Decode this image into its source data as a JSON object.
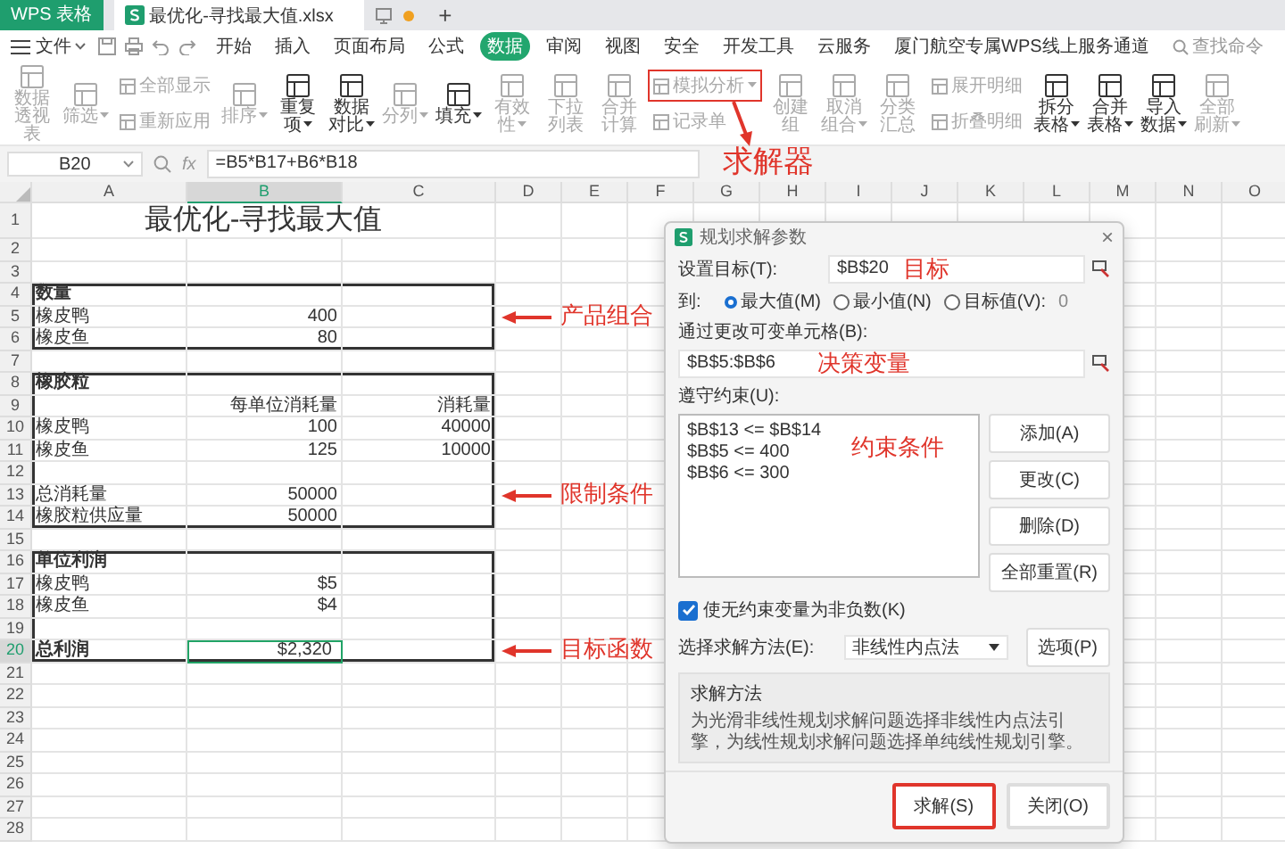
{
  "title_bar": {
    "app_tab": "WPS 表格",
    "file_tab": "最优化-寻找最大值.xlsx",
    "new_tab": "+"
  },
  "menu": {
    "file": "文件",
    "tabs": [
      {
        "label": "开始",
        "selected": false
      },
      {
        "label": "插入",
        "selected": false
      },
      {
        "label": "页面布局",
        "selected": false
      },
      {
        "label": "公式",
        "selected": false
      },
      {
        "label": "数据",
        "selected": true
      },
      {
        "label": "审阅",
        "selected": false
      },
      {
        "label": "视图",
        "selected": false
      },
      {
        "label": "安全",
        "selected": false
      },
      {
        "label": "开发工具",
        "selected": false
      },
      {
        "label": "云服务",
        "selected": false
      },
      {
        "label": "厦门航空专属WPS线上服务通道",
        "selected": false
      }
    ],
    "search_placeholder": "查找命令"
  },
  "toolbar": [
    {
      "kind": "large",
      "label": "数据透视表",
      "dropdown": false,
      "disabled": true
    },
    {
      "kind": "large",
      "label": "筛选",
      "dropdown": true,
      "disabled": true
    },
    {
      "kind": "stack",
      "items": [
        {
          "label": "全部显示",
          "dropdown": false,
          "disabled": true,
          "highlighted": false
        },
        {
          "label": "重新应用",
          "dropdown": false,
          "disabled": true,
          "highlighted": false
        }
      ]
    },
    {
      "kind": "large",
      "label": "排序",
      "dropdown": true,
      "disabled": true
    },
    {
      "kind": "large",
      "label": "重复项",
      "dropdown": true,
      "disabled": false
    },
    {
      "kind": "large",
      "label": "数据对比",
      "dropdown": true,
      "disabled": false
    },
    {
      "kind": "large",
      "label": "分列",
      "dropdown": true,
      "disabled": true
    },
    {
      "kind": "large",
      "label": "填充",
      "dropdown": true,
      "disabled": false
    },
    {
      "kind": "large",
      "label": "有效性",
      "dropdown": true,
      "disabled": true
    },
    {
      "kind": "large",
      "label": "下拉列表",
      "dropdown": false,
      "disabled": true
    },
    {
      "kind": "large",
      "label": "合并计算",
      "dropdown": false,
      "disabled": true
    },
    {
      "kind": "stack",
      "items": [
        {
          "label": "模拟分析",
          "dropdown": true,
          "disabled": true,
          "highlighted": true,
          "note": "求解器"
        },
        {
          "label": "记录单",
          "dropdown": false,
          "disabled": true,
          "highlighted": false
        }
      ]
    },
    {
      "kind": "large",
      "label": "创建组",
      "dropdown": false,
      "disabled": true
    },
    {
      "kind": "large",
      "label": "取消组合",
      "dropdown": true,
      "disabled": true
    },
    {
      "kind": "large",
      "label": "分类汇总",
      "dropdown": false,
      "disabled": true
    },
    {
      "kind": "stack",
      "items": [
        {
          "label": "展开明细",
          "dropdown": false,
          "disabled": true,
          "highlighted": false
        },
        {
          "label": "折叠明细",
          "dropdown": false,
          "disabled": true,
          "highlighted": false
        }
      ]
    },
    {
      "kind": "large",
      "label": "拆分表格",
      "dropdown": true,
      "disabled": false
    },
    {
      "kind": "large",
      "label": "合并表格",
      "dropdown": true,
      "disabled": false
    },
    {
      "kind": "large",
      "label": "导入数据",
      "dropdown": true,
      "disabled": false
    },
    {
      "kind": "large",
      "label": "全部刷新",
      "dropdown": true,
      "disabled": true
    }
  ],
  "formula_bar": {
    "name_box": "B20",
    "fx_label": "fx",
    "formula": "=B5*B17+B6*B18"
  },
  "sheet": {
    "columns": [
      {
        "label": "A",
        "selected": false
      },
      {
        "label": "B",
        "selected": true
      },
      {
        "label": "C",
        "selected": false
      },
      {
        "label": "D",
        "selected": false
      },
      {
        "label": "E",
        "selected": false
      },
      {
        "label": "F",
        "selected": false
      },
      {
        "label": "G",
        "selected": false
      },
      {
        "label": "H",
        "selected": false
      },
      {
        "label": "I",
        "selected": false
      },
      {
        "label": "J",
        "selected": false
      },
      {
        "label": "K",
        "selected": false
      },
      {
        "label": "L",
        "selected": false
      },
      {
        "label": "M",
        "selected": false
      },
      {
        "label": "N",
        "selected": false
      },
      {
        "label": "O",
        "selected": false
      }
    ],
    "sections": [
      {
        "boxed": false,
        "rows": [
          {
            "num": "1",
            "selected": false,
            "kind": "title",
            "a": "最优化-寻找最大值"
          },
          {
            "num": "2",
            "selected": false,
            "kind": "data"
          },
          {
            "num": "3",
            "selected": false,
            "kind": "data"
          }
        ]
      },
      {
        "boxed": true,
        "rows": [
          {
            "num": "4",
            "selected": false,
            "kind": "heading",
            "a": "数量"
          },
          {
            "num": "5",
            "selected": false,
            "kind": "data",
            "a": "橡皮鸭",
            "b": "400",
            "note": "产品组合"
          },
          {
            "num": "6",
            "selected": false,
            "kind": "data",
            "a": "橡皮鱼",
            "b": "80"
          }
        ]
      },
      {
        "boxed": false,
        "rows": [
          {
            "num": "7",
            "selected": false,
            "kind": "data"
          }
        ]
      },
      {
        "boxed": true,
        "rows": [
          {
            "num": "8",
            "selected": false,
            "kind": "heading",
            "a": "橡胶粒"
          },
          {
            "num": "9",
            "selected": false,
            "kind": "data",
            "b": "每单位消耗量",
            "c": "消耗量"
          },
          {
            "num": "10",
            "selected": false,
            "kind": "data",
            "a": "橡皮鸭",
            "b": "100",
            "c": "40000"
          },
          {
            "num": "11",
            "selected": false,
            "kind": "data",
            "a": "橡皮鱼",
            "b": "125",
            "c": "10000"
          },
          {
            "num": "12",
            "selected": false,
            "kind": "data"
          },
          {
            "num": "13",
            "selected": false,
            "kind": "data",
            "a": "总消耗量",
            "b": "50000",
            "note": "限制条件"
          },
          {
            "num": "14",
            "selected": false,
            "kind": "data",
            "a": "橡胶粒供应量",
            "b": "50000"
          }
        ]
      },
      {
        "boxed": false,
        "rows": [
          {
            "num": "15",
            "selected": false,
            "kind": "data"
          }
        ]
      },
      {
        "boxed": true,
        "rows": [
          {
            "num": "16",
            "selected": false,
            "kind": "heading",
            "a": "单位利润"
          },
          {
            "num": "17",
            "selected": false,
            "kind": "data",
            "a": "橡皮鸭",
            "b": "$5"
          },
          {
            "num": "18",
            "selected": false,
            "kind": "data",
            "a": "橡皮鱼",
            "b": "$4"
          },
          {
            "num": "19",
            "selected": false,
            "kind": "data"
          },
          {
            "num": "20",
            "selected": true,
            "kind": "heading",
            "a": "总利润",
            "b": "$2,320",
            "note": "目标函数"
          }
        ]
      },
      {
        "boxed": false,
        "rows": [
          {
            "num": "21",
            "selected": false,
            "kind": "data"
          },
          {
            "num": "22",
            "selected": false,
            "kind": "data"
          },
          {
            "num": "23",
            "selected": false,
            "kind": "data"
          },
          {
            "num": "24",
            "selected": false,
            "kind": "data"
          },
          {
            "num": "25",
            "selected": false,
            "kind": "data"
          },
          {
            "num": "26",
            "selected": false,
            "kind": "data"
          },
          {
            "num": "27",
            "selected": false,
            "kind": "data"
          },
          {
            "num": "28",
            "selected": false,
            "kind": "data"
          }
        ]
      }
    ]
  },
  "dialog": {
    "title": "规划求解参数",
    "close": "×",
    "target_label": "设置目标(T):",
    "target_value": "$B$20",
    "target_note": "目标",
    "to_label": "到:",
    "options": [
      {
        "label": "最大值(M)",
        "selected": true
      },
      {
        "label": "最小值(N)",
        "selected": false
      },
      {
        "label": "目标值(V):",
        "selected": false
      }
    ],
    "target_amount": "0",
    "variables_label": "通过更改可变单元格(B):",
    "variables_value": "$B$5:$B$6",
    "variables_note": "决策变量",
    "constraints_label": "遵守约束(U):",
    "constraints": [
      "$B$13 <= $B$14",
      "$B$5 <= 400",
      "$B$6 <= 300"
    ],
    "constraints_note": "约束条件",
    "side_buttons": [
      "添加(A)",
      "更改(C)",
      "删除(D)",
      "全部重置(R)"
    ],
    "nonneg": {
      "label": "使无约束变量为非负数(K)",
      "checked": true
    },
    "method_label": "选择求解方法(E):",
    "method_value": "非线性内点法",
    "options_button": "选项(P)",
    "method_group": {
      "title": "求解方法",
      "text": "为光滑非线性规划求解问题选择非线性内点法引擎，为线性规划求解问题选择单纯线性规划引擎。"
    },
    "footer_buttons": [
      {
        "label": "求解(S)",
        "highlighted": true
      },
      {
        "label": "关闭(O)",
        "highlighted": false
      }
    ]
  }
}
